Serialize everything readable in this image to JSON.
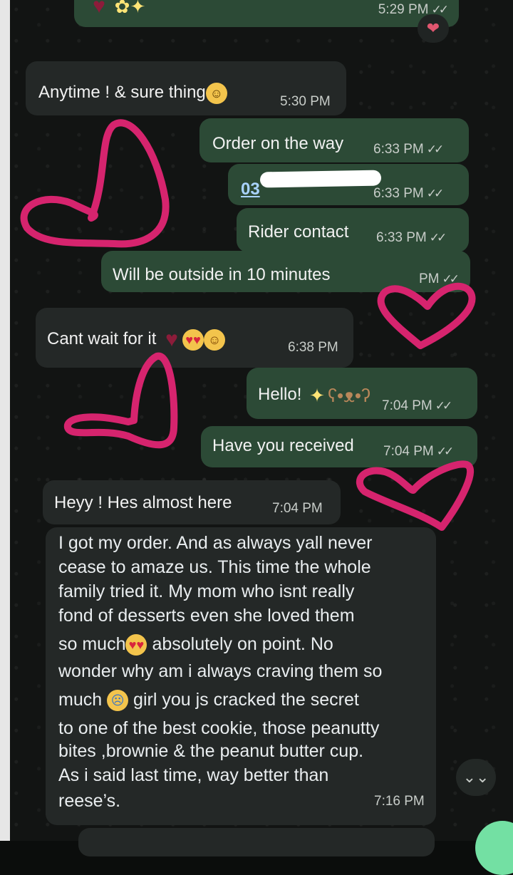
{
  "chat": {
    "top_partial": {
      "time": "5:29 PM",
      "ticks": "✓✓",
      "reaction": "❤"
    },
    "messages": [
      {
        "id": "m1",
        "dir": "in",
        "text": "Anytime ! & sure thing",
        "emoji": "grin",
        "time": "5:30 PM"
      },
      {
        "id": "m2",
        "dir": "out",
        "text": "Order on the way",
        "time": "6:33 PM",
        "ticks": "✓✓"
      },
      {
        "id": "m3",
        "dir": "out",
        "text": "03",
        "time": "6:33 PM",
        "ticks": "✓✓",
        "note": "phone number partially hidden"
      },
      {
        "id": "m4",
        "dir": "out",
        "text": "Rider contact",
        "time": "6:33 PM",
        "ticks": "✓✓"
      },
      {
        "id": "m5",
        "dir": "out",
        "text": "Will be outside in 10 minutes",
        "time": "PM",
        "ticks": "✓✓"
      },
      {
        "id": "m6",
        "dir": "in",
        "text": "Cant wait for it",
        "emojis": [
          "heart",
          "heart-eyes",
          "yum"
        ],
        "time": "6:38 PM"
      },
      {
        "id": "m7",
        "dir": "out",
        "text": "Hello!",
        "emojis": [
          "sparkles",
          "teddy-bear"
        ],
        "time": "7:04 PM",
        "ticks": "✓✓"
      },
      {
        "id": "m8",
        "dir": "out",
        "text": "Have you received",
        "time": "7:04 PM",
        "ticks": "✓✓"
      },
      {
        "id": "m9",
        "dir": "in",
        "text": "Heyy ! Hes almost here",
        "time": "7:04 PM"
      },
      {
        "id": "m10",
        "dir": "in",
        "time": "7:16 PM",
        "lines": [
          "I got my order. And as always yall never",
          "cease to amaze us. This time the whole",
          "family tried it. My mom who isnt really",
          "fond of desserts even she loved them",
          "so much",
          "absolutely on point. No",
          "wonder why am i always craving them so",
          "much",
          "girl you js cracked the secret",
          "to one of the best cookie, those peanutty",
          "bites ,brownie & the peanut butter cup.",
          "As i said last time, way better than",
          "reese’s."
        ]
      }
    ],
    "scroll_button_icon": "double-chevron-down-icon",
    "scroll_button_glyph": "⌄⌄"
  },
  "colors": {
    "incoming": "#242827",
    "outgoing": "#2c4a36",
    "doodle": "#d6246e",
    "fab": "#73e0a3"
  }
}
